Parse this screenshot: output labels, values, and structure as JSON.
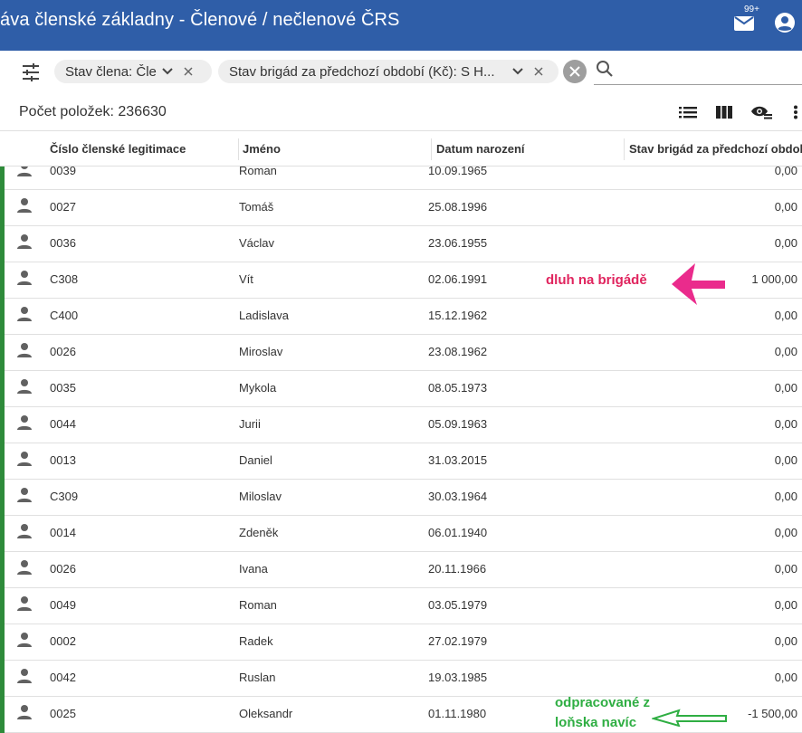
{
  "header": {
    "title": "áva členské základny - Členové / nečlenové ČRS",
    "badge": "99+"
  },
  "filters": {
    "chip1": "Stav člena: Člen",
    "chip2": "Stav brigád za předchozí období (Kč): S H...",
    "search_placeholder": ""
  },
  "count_label": "Počet položek: 236630",
  "columns": {
    "id": "Číslo členské legitimace",
    "name": "Jméno",
    "birth": "Datum narození",
    "brigade": "Stav brigád za předchozí období..."
  },
  "rows": [
    {
      "id": "0039",
      "name": "Roman",
      "birth": "10.09.1965",
      "brigade": "0,00"
    },
    {
      "id": "0027",
      "name": "Tomáš",
      "birth": "25.08.1996",
      "brigade": "0,00"
    },
    {
      "id": "0036",
      "name": "Václav",
      "birth": "23.06.1955",
      "brigade": "0,00"
    },
    {
      "id": "C308",
      "name": "Vít",
      "birth": "02.06.1991",
      "brigade": "1 000,00"
    },
    {
      "id": "C400",
      "name": "Ladislava",
      "birth": "15.12.1962",
      "brigade": "0,00"
    },
    {
      "id": "0026",
      "name": "Miroslav",
      "birth": "23.08.1962",
      "brigade": "0,00"
    },
    {
      "id": "0035",
      "name": "Mykola",
      "birth": "08.05.1973",
      "brigade": "0,00"
    },
    {
      "id": "0044",
      "name": "Jurii",
      "birth": "05.09.1963",
      "brigade": "0,00"
    },
    {
      "id": "0013",
      "name": "Daniel",
      "birth": "31.03.2015",
      "brigade": "0,00"
    },
    {
      "id": "C309",
      "name": "Miloslav",
      "birth": "30.03.1964",
      "brigade": "0,00"
    },
    {
      "id": "0014",
      "name": "Zdeněk",
      "birth": "06.01.1940",
      "brigade": "0,00"
    },
    {
      "id": "0026",
      "name": "Ivana",
      "birth": "20.11.1966",
      "brigade": "0,00"
    },
    {
      "id": "0049",
      "name": "Roman",
      "birth": "03.05.1979",
      "brigade": "0,00"
    },
    {
      "id": "0002",
      "name": "Radek",
      "birth": "27.02.1979",
      "brigade": "0,00"
    },
    {
      "id": "0042",
      "name": "Ruslan",
      "birth": "19.03.1985",
      "brigade": "0,00"
    },
    {
      "id": "0025",
      "name": "Oleksandr",
      "birth": "01.11.1980",
      "brigade": "-1 500,00"
    }
  ],
  "annotations": {
    "debt": "dluh na brigádě",
    "extra_line1": "odpracované z",
    "extra_line2": "loňska navíc"
  },
  "colors": {
    "appbar": "#2f5ea8",
    "annotation_pink": "#e0245e",
    "annotation_green": "#2fae43",
    "row_marker": "#2e8b3a"
  }
}
